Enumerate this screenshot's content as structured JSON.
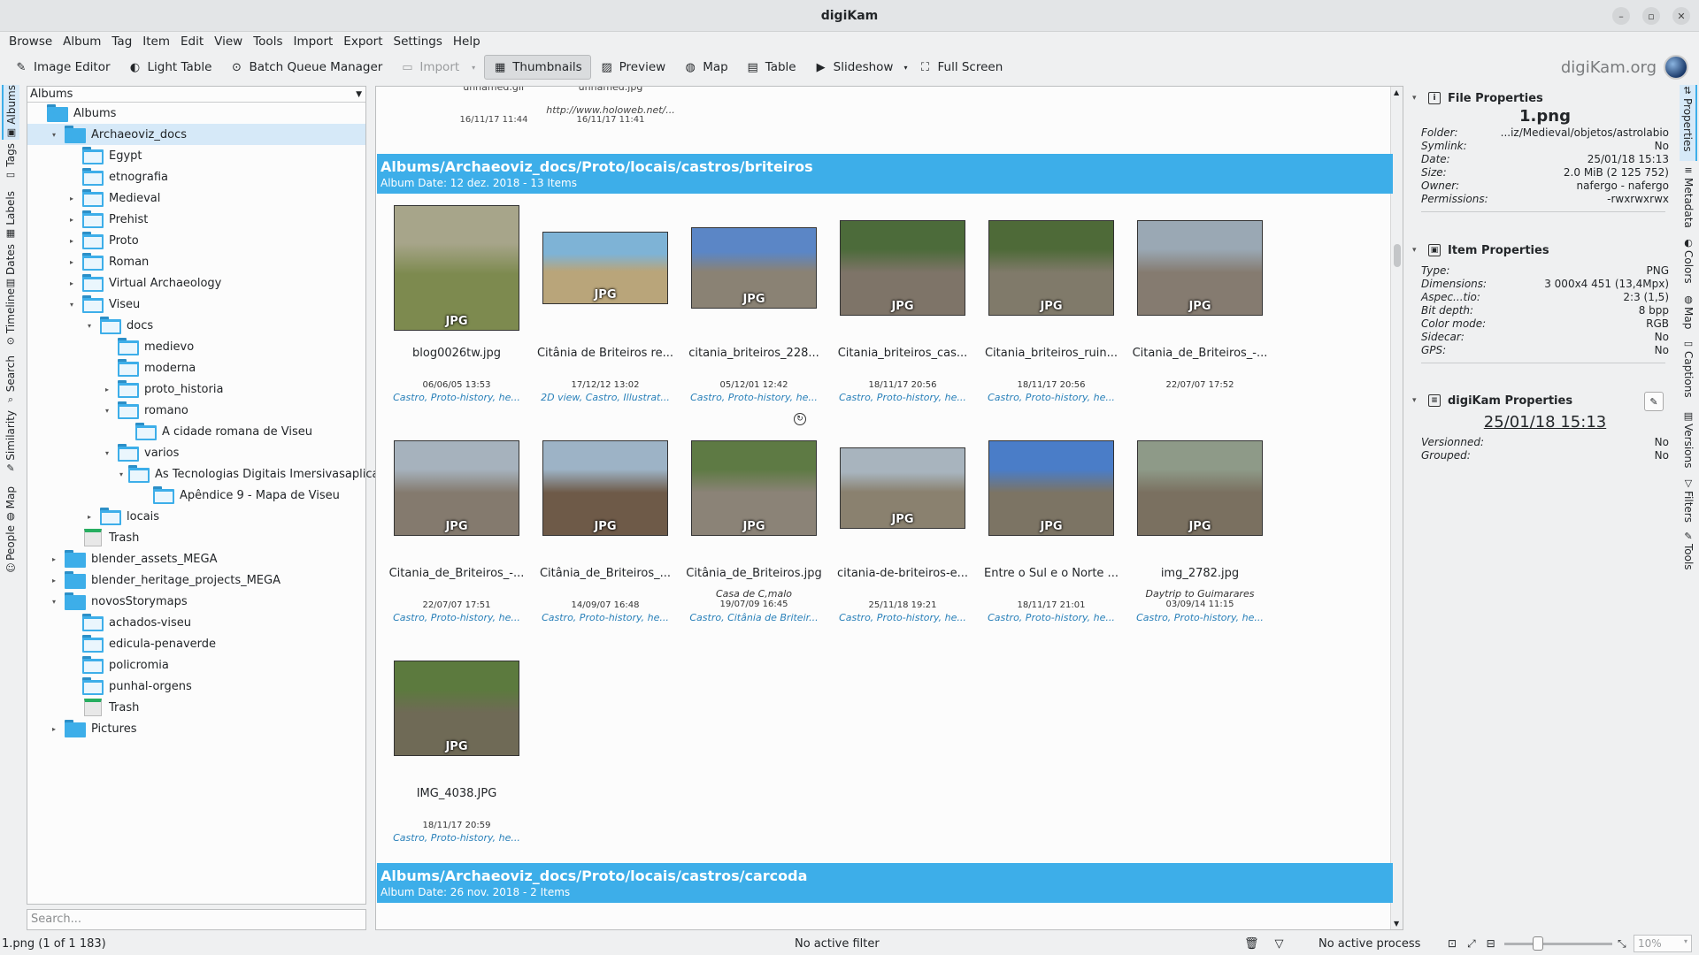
{
  "window": {
    "title": "digiKam"
  },
  "menu": [
    "Browse",
    "Album",
    "Tag",
    "Item",
    "Edit",
    "View",
    "Tools",
    "Import",
    "Export",
    "Settings",
    "Help"
  ],
  "toolbar": {
    "image_editor": "Image Editor",
    "light_table": "Light Table",
    "batch_queue": "Batch Queue Manager",
    "import": "Import",
    "thumbnails": "Thumbnails",
    "preview": "Preview",
    "map": "Map",
    "table": "Table",
    "slideshow": "Slideshow",
    "full_screen": "Full Screen",
    "brand": "digiKam.org"
  },
  "left_tabs": [
    "Albums",
    "Tags",
    "Labels",
    "Dates",
    "Timeline",
    "Search",
    "Similarity",
    "Map",
    "People"
  ],
  "albums_panel": {
    "header": "Albums",
    "search_placeholder": "Search...",
    "tree": [
      {
        "label": "Albums",
        "level": 0,
        "exp": "",
        "kind": "root"
      },
      {
        "label": "Archaeoviz_docs",
        "level": 1,
        "exp": "▾",
        "kind": "cam",
        "selected": true
      },
      {
        "label": "Egypt",
        "level": 2,
        "exp": "",
        "kind": "folder"
      },
      {
        "label": "etnografia",
        "level": 2,
        "exp": "",
        "kind": "folder"
      },
      {
        "label": "Medieval",
        "level": 2,
        "exp": "▸",
        "kind": "folder"
      },
      {
        "label": "Prehist",
        "level": 2,
        "exp": "▸",
        "kind": "folder"
      },
      {
        "label": "Proto",
        "level": 2,
        "exp": "▸",
        "kind": "folder"
      },
      {
        "label": "Roman",
        "level": 2,
        "exp": "▸",
        "kind": "folder"
      },
      {
        "label": "Virtual Archaeology",
        "level": 2,
        "exp": "▸",
        "kind": "folder"
      },
      {
        "label": "Viseu",
        "level": 2,
        "exp": "▾",
        "kind": "folder"
      },
      {
        "label": "docs",
        "level": 3,
        "exp": "▾",
        "kind": "folder"
      },
      {
        "label": "medievo",
        "level": 4,
        "exp": "",
        "kind": "folder"
      },
      {
        "label": "moderna",
        "level": 4,
        "exp": "",
        "kind": "folder"
      },
      {
        "label": "proto_historia",
        "level": 4,
        "exp": "▸",
        "kind": "folder"
      },
      {
        "label": "romano",
        "level": 4,
        "exp": "▾",
        "kind": "folder"
      },
      {
        "label": "A cidade romana de Viseu",
        "level": 5,
        "exp": "",
        "kind": "folder"
      },
      {
        "label": "varios",
        "level": 4,
        "exp": "▾",
        "kind": "folder"
      },
      {
        "label": "As Tecnologias Digitais Imersivasaplica...",
        "level": 5,
        "exp": "▾",
        "kind": "folder"
      },
      {
        "label": "Apêndice 9 - Mapa de Viseu",
        "level": 6,
        "exp": "",
        "kind": "folder"
      },
      {
        "label": "locais",
        "level": 3,
        "exp": "▸",
        "kind": "folder"
      },
      {
        "label": "Trash",
        "level": 2,
        "exp": "",
        "kind": "trash"
      },
      {
        "label": "blender_assets_MEGA",
        "level": 1,
        "exp": "▸",
        "kind": "cam"
      },
      {
        "label": "blender_heritage_projects_MEGA",
        "level": 1,
        "exp": "▸",
        "kind": "cam"
      },
      {
        "label": "novosStorymaps",
        "level": 1,
        "exp": "▾",
        "kind": "cam"
      },
      {
        "label": "achados-viseu",
        "level": 2,
        "exp": "",
        "kind": "folder"
      },
      {
        "label": "edicula-penaverde",
        "level": 2,
        "exp": "",
        "kind": "folder"
      },
      {
        "label": "policromia",
        "level": 2,
        "exp": "",
        "kind": "folder"
      },
      {
        "label": "punhal-orgens",
        "level": 2,
        "exp": "",
        "kind": "folder"
      },
      {
        "label": "Trash",
        "level": 2,
        "exp": "",
        "kind": "trash"
      },
      {
        "label": "Pictures",
        "level": 1,
        "exp": "▸",
        "kind": "cam"
      }
    ]
  },
  "main": {
    "prev_items": [
      {
        "name": "unnamed.gif",
        "date": "16/11/17 11:44",
        "extra": ""
      },
      {
        "name": "unnamed.jpg",
        "date": "16/11/17 11:41",
        "extra": "http://www.holoweb.net/..."
      }
    ],
    "groups": [
      {
        "title": "Albums/Archaeoviz_docs/Proto/locais/castros/briteiros",
        "subtitle": "Album Date: 12 dez. 2018 - 13 Items",
        "items": [
          {
            "name": "blog0026tw.jpg",
            "caption": "",
            "date": "06/06/05 13:53",
            "tags": "Castro, Proto-history, he...",
            "color": "#7d8a4f",
            "color2": "#a7a58a"
          },
          {
            "name": "Citânia de Briteiros re...",
            "caption": "",
            "date": "17/12/12 13:02",
            "tags": "2D view, Castro, Illustrat...",
            "color": "#b9a57a",
            "color2": "#7eb3d6"
          },
          {
            "name": "citania_briteiros_228...",
            "caption": "",
            "date": "05/12/01 12:42",
            "tags": "Castro, Proto-history, he...",
            "color": "#8a8274",
            "color2": "#5b86c6"
          },
          {
            "name": "Citania_briteiros_cas...",
            "caption": "",
            "date": "18/11/17 20:56",
            "tags": "Castro, Proto-history, he...",
            "color": "#7e7468",
            "color2": "#4c6b3a"
          },
          {
            "name": "Citania_briteiros_ruin...",
            "caption": "",
            "date": "18/11/17 20:56",
            "tags": "Castro, Proto-history, he...",
            "color": "#807a6a",
            "color2": "#4e6a38"
          },
          {
            "name": "Citania_de_Briteiros_-...",
            "caption": "",
            "date": "22/07/07 17:52",
            "tags": "",
            "color": "#857b70",
            "color2": "#9aa8b4"
          },
          {
            "name": "Citania_de_Briteiros_-...",
            "caption": "",
            "date": "22/07/07 17:51",
            "tags": "Castro, Proto-history, he...",
            "color": "#847a6e",
            "color2": "#a6b2bd"
          },
          {
            "name": "Citânia_de_Briteiros_...",
            "caption": "",
            "date": "14/09/07 16:48",
            "tags": "Castro, Proto-history, he...",
            "color": "#6e5a48",
            "color2": "#9db3c6"
          },
          {
            "name": "Citânia_de_Briteiros.jpg",
            "caption": "Casa de C,malo",
            "date": "19/07/09 16:45",
            "tags": "Castro, Citânia de Briteir...",
            "color": "#8b8377",
            "color2": "#5e7a44"
          },
          {
            "name": "citania-de-briteiros-e...",
            "caption": "",
            "date": "25/11/18 19:21",
            "tags": "Castro, Proto-history, he...",
            "color": "#8a816f",
            "color2": "#a8b4be"
          },
          {
            "name": "Entre o Sul e o Norte ...",
            "caption": "",
            "date": "18/11/17 21:01",
            "tags": "Castro, Proto-history, he...",
            "color": "#7c7464",
            "color2": "#4a7dc8"
          },
          {
            "name": "img_2782.jpg",
            "caption": "Daytrip to Guimarares",
            "date": "03/09/14 11:15",
            "tags": "Castro, Proto-history, he...",
            "color": "#7a7060",
            "color2": "#8e9a88"
          },
          {
            "name": "IMG_4038.JPG",
            "caption": "",
            "date": "18/11/17 20:59",
            "tags": "Castro, Proto-history, he...",
            "color": "#6f6a56",
            "color2": "#5c7a3e"
          }
        ]
      },
      {
        "title": "Albums/Archaeoviz_docs/Proto/locais/castros/carcoda",
        "subtitle": "Album Date: 26 nov. 2018 - 2 Items"
      }
    ],
    "thumb_badge": "JPG"
  },
  "right_panel": {
    "file_props": {
      "header": "File Properties",
      "filename": "1.png",
      "rows": [
        [
          "Folder:",
          "...iz/Medieval/objetos/astrolabio"
        ],
        [
          "Symlink:",
          "No"
        ],
        [
          "Date:",
          "25/01/18 15:13"
        ],
        [
          "Size:",
          "2.0 MiB (2 125 752)"
        ],
        [
          "Owner:",
          "nafergo - nafergo"
        ],
        [
          "Permissions:",
          "-rwxrwxrwx"
        ]
      ]
    },
    "item_props": {
      "header": "Item Properties",
      "rows": [
        [
          "Type:",
          "PNG"
        ],
        [
          "Dimensions:",
          "3 000x4 451 (13,4Mpx)"
        ],
        [
          "Aspec...tio:",
          "2:3 (1,5)"
        ],
        [
          "Bit depth:",
          "8 bpp"
        ],
        [
          "Color mode:",
          "RGB"
        ],
        [
          "Sidecar:",
          "No"
        ],
        [
          "GPS:",
          "No"
        ]
      ]
    },
    "digikam_props": {
      "header": "digiKam Properties",
      "big_date": "25/01/18 15:13",
      "rows": [
        [
          "Versionned:",
          "No"
        ],
        [
          "Grouped:",
          "No"
        ]
      ]
    }
  },
  "right_tabs": [
    "Properties",
    "Metadata",
    "Colors",
    "Map",
    "Captions",
    "Versions",
    "Filters",
    "Tools"
  ],
  "status": {
    "item": "1.png (1 of 1 183)",
    "filter": "No active filter",
    "process": "No active process",
    "zoom": "10%"
  }
}
